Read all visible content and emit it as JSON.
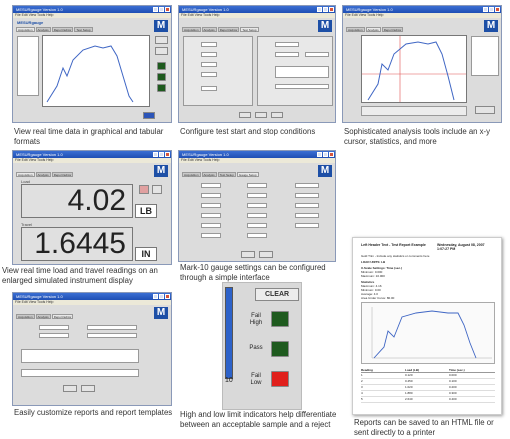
{
  "windows": {
    "title": "MESURgauge Version 1.0",
    "menu": "File  Edit  View  Tools  Help",
    "logo": "M",
    "brand": "MESURgauge",
    "tabs": [
      "Acquisition",
      "Analysis",
      "Report Editor",
      "Test Setup",
      "Gauge Setup",
      "Options",
      "Preferences"
    ]
  },
  "captions": {
    "c1": "View real time data in graphical and tabular formats",
    "c2": "Configure test start and stop conditions",
    "c3": "Sophisticated analysis tools include an x-y cursor, statistics, and more",
    "c4": "View real time load and travel readings on an enlarged simulated instrument display",
    "c5": "Mark-10 gauge settings can be configured through a simple interface",
    "c6": "Easily customize reports and report templates",
    "c7": "High and low limit indicators help differentiate between an acceptable sample and a reject",
    "c8": "Reports can be saved to an HTML file or sent directly to a printer"
  },
  "instrument": {
    "load_label": "Load",
    "load_value": "4.02",
    "load_unit": "LB",
    "travel_label": "Travel",
    "travel_value": "1.6445",
    "travel_unit": "IN"
  },
  "limits": {
    "clear_label": "CLEAR",
    "fail_high": "Fail High",
    "pass": "Pass",
    "fail_low": "Fail Low",
    "scale_value": "10",
    "colors": {
      "fail_high": "#1e5a1e",
      "pass": "#1e5a1e",
      "fail_low": "#e0201c"
    }
  },
  "report": {
    "header_left": "Left Header Text - Test Report Example",
    "header_right": "Wednesday, August 08, 2007 1:07:27 PM",
    "comment": "Gold Trim - Include any statistics or comments here",
    "load_units": "LOAD UNITS: LB",
    "x_scale": "X-Scale Settings: Time (sec.)",
    "x_min": "Minimum: 0.000",
    "x_max": "Maximum: 10.000",
    "stats_title": "Statistics",
    "stat_max": "Maximum: 4.16",
    "stat_min": "Minimum: 0.00",
    "stat_avg": "Average: 4.0",
    "stat_area": "Area Under Curve: 80.00",
    "table_headers": [
      "Reading",
      "Load (LB)",
      "Time (sec.)"
    ],
    "table_rows": [
      [
        "1",
        "0.120",
        "0.000"
      ],
      [
        "2",
        "0.450",
        "0.100"
      ],
      [
        "3",
        "1.020",
        "0.200"
      ],
      [
        "4",
        "1.880",
        "0.300"
      ],
      [
        "5",
        "2.640",
        "0.400"
      ]
    ]
  }
}
